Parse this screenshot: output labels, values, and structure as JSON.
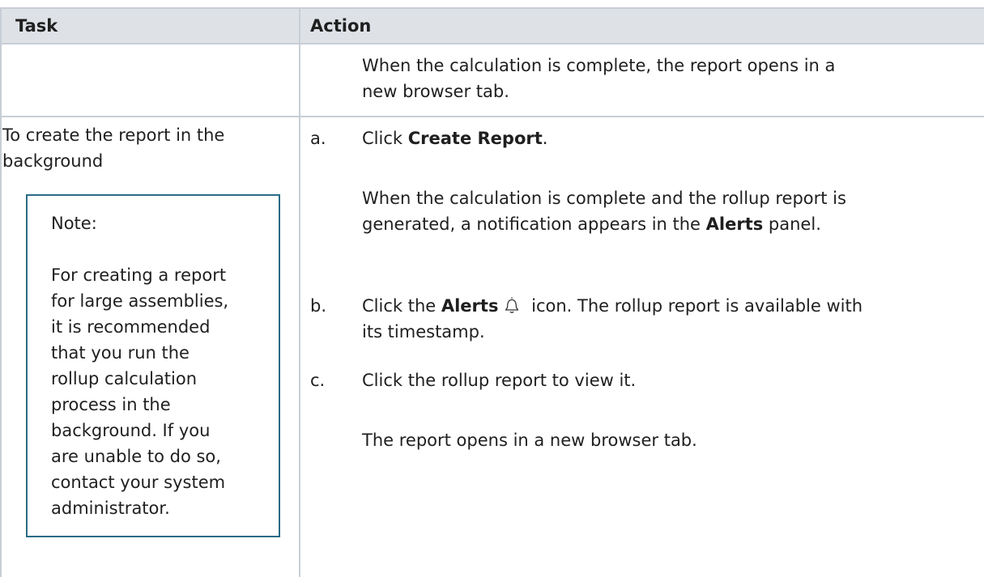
{
  "header": {
    "task_label": "Task",
    "action_label": "Action"
  },
  "row1": {
    "action_text_line1": "When the calculation is complete, the report opens in a",
    "action_text_line2": "new browser tab."
  },
  "row2": {
    "task_line1": "To create the report in the",
    "task_line2": "background",
    "note": {
      "label": "Note:",
      "body_lines": [
        "For creating a report",
        "for large assemblies,",
        "it is recommended",
        "that you run the",
        "rollup calculation",
        "process in the",
        "background. If you",
        "are unable to do so,",
        "contact your system",
        "administrator."
      ]
    },
    "steps": {
      "a": {
        "letter": "a.",
        "prefix": "Click ",
        "bold": "Create Report",
        "suffix": ".",
        "result_line1": "When the calculation is complete and the rollup report is",
        "result_line2_prefix": "generated, a notification appears in the ",
        "result_line2_bold": "Alerts",
        "result_line2_suffix": " panel."
      },
      "b": {
        "letter": "b.",
        "prefix": "Click the ",
        "bold": "Alerts",
        "suffix": " icon. The rollup report is available with",
        "line2": "its timestamp.",
        "icon": "bell-icon"
      },
      "c": {
        "letter": "c.",
        "text": "Click the rollup report to view it.",
        "result": "The report opens in a new browser tab."
      }
    }
  },
  "colors": {
    "header_bg": "#dee2e7",
    "grid": "#c8ced6",
    "note_border": "#2b6b86"
  }
}
